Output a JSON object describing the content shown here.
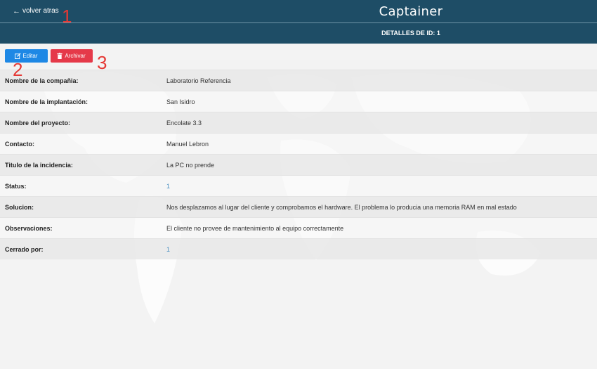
{
  "header": {
    "back_label": "volver atras",
    "brand": "Captainer",
    "subtitle": "DETALLES DE ID: 1"
  },
  "actions": {
    "edit_label": "Editar",
    "archive_label": "Archivar"
  },
  "annotations": [
    "1",
    "2",
    "3"
  ],
  "details": [
    {
      "label": "Nombre de la compañia:",
      "value": "Laboratorio Referencia"
    },
    {
      "label": "Nombre de la implantación:",
      "value": "San Isidro"
    },
    {
      "label": "Nombre del proyecto:",
      "value": "Encolate 3.3"
    },
    {
      "label": "Contacto:",
      "value": "Manuel Lebron"
    },
    {
      "label": "Titulo de la incidencia:",
      "value": "La PC no prende"
    },
    {
      "label": "Status:",
      "value": "1"
    },
    {
      "label": "Solucion:",
      "value": "Nos desplazamos al lugar del cliente y comprobamos el hardware. El problema lo producia una memoria RAM en mal estado"
    },
    {
      "label": "Observaciones:",
      "value": "El cliente no provee de mantenimiento al equipo correctamente"
    },
    {
      "label": "Cerrado por:",
      "value": "1"
    }
  ],
  "colors": {
    "header_bg": "#1e4d66",
    "edit_button": "#1e88e5",
    "archive_button": "#e53949",
    "annotation": "#e53935",
    "numeric_value": "#4a90c2"
  }
}
